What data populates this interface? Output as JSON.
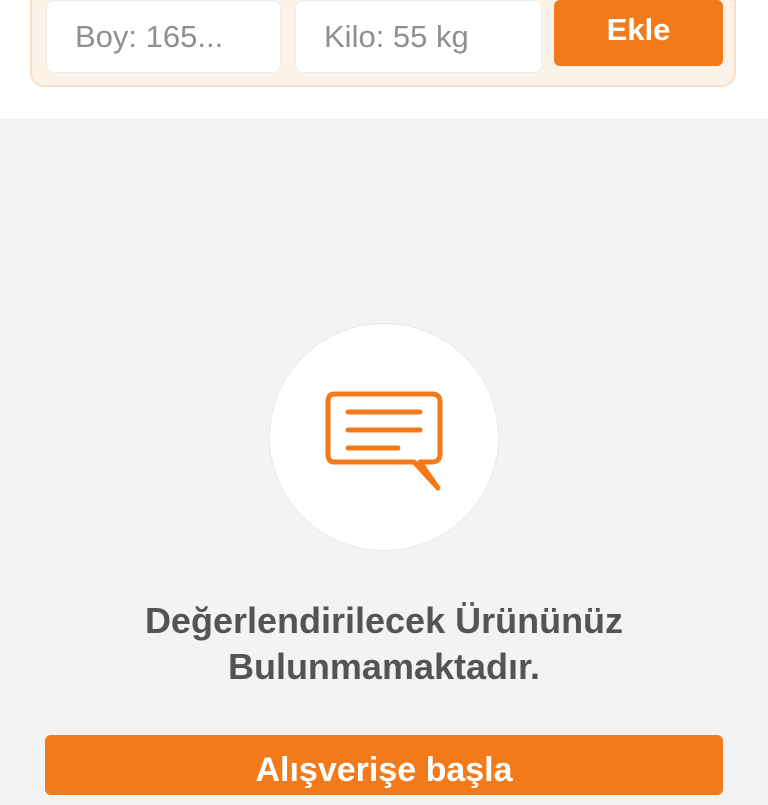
{
  "measurements": {
    "height_field": {
      "value": "Boy: 165..."
    },
    "weight_field": {
      "value": "Kilo: 55 kg"
    },
    "add_label": "Ekle"
  },
  "empty_state": {
    "icon": "chat-message-icon",
    "message_line1": "Değerlendirilecek Ürününüz",
    "message_line2": "Bulunmamaktadır."
  },
  "cta": {
    "label": "Alışverişe başla"
  },
  "colors": {
    "accent": "#f27a1a",
    "background": "#f3f3f3",
    "card_bg": "#fdf2e8",
    "text": "#545454"
  }
}
